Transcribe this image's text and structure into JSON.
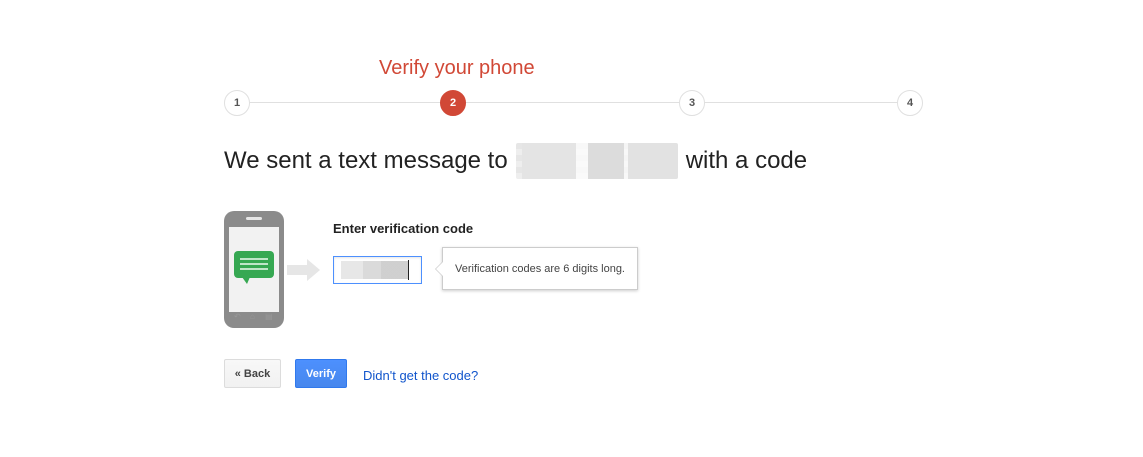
{
  "steps": {
    "current_title": "Verify your phone",
    "items": [
      "1",
      "2",
      "3",
      "4"
    ],
    "active_index": 1
  },
  "heading": {
    "prefix": "We sent a text message to",
    "suffix": "with a code"
  },
  "form": {
    "label": "Enter verification code",
    "tooltip": "Verification codes are 6 digits long."
  },
  "actions": {
    "back_label": "« Back",
    "verify_label": "Verify",
    "resend_link": "Didn't get the code?"
  },
  "colors": {
    "accent_red": "#d14836",
    "primary_blue": "#4d90fe",
    "link_blue": "#1155cc",
    "message_green": "#36a852"
  },
  "icons": {
    "phone": "phone-illustration-icon",
    "message": "chat-bubble-icon",
    "arrow": "right-arrow-icon"
  }
}
